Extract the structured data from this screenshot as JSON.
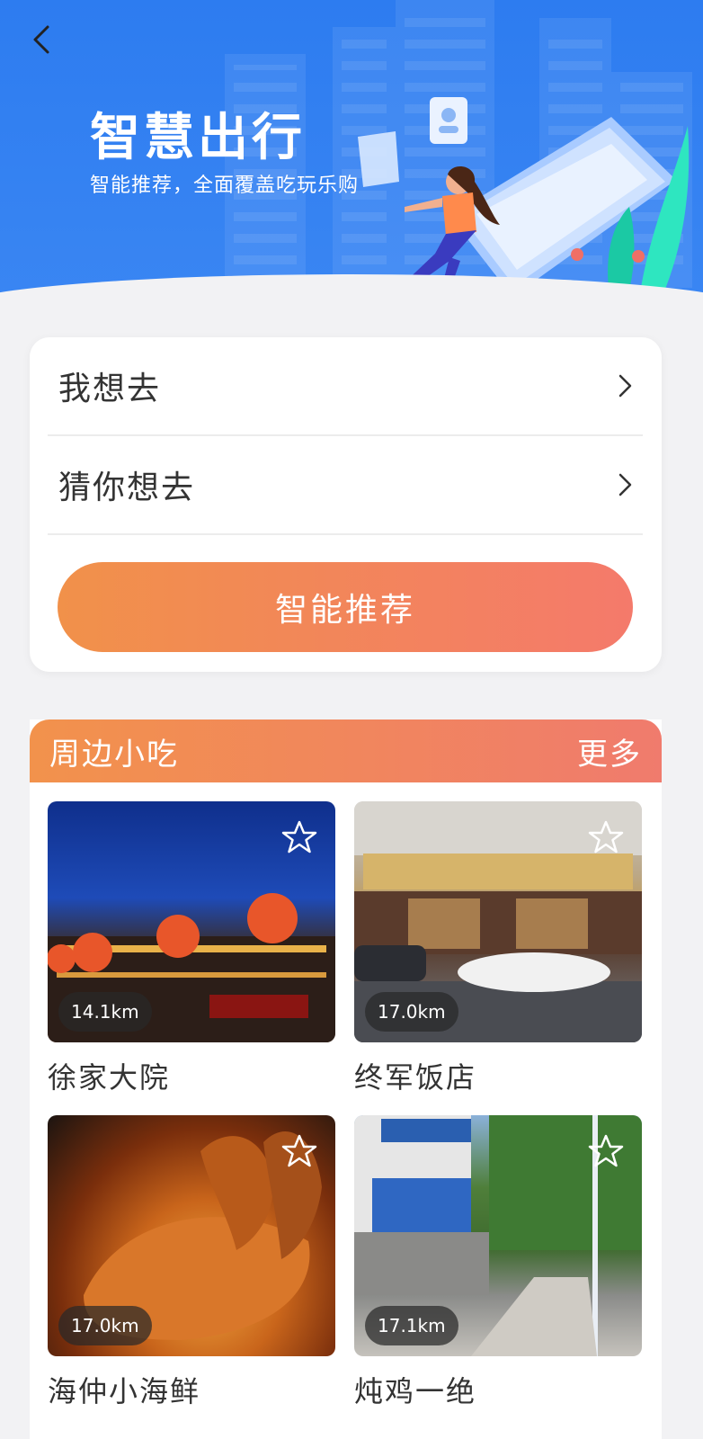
{
  "header": {
    "title": "智慧出行",
    "subtitle": "智能推荐，全面覆盖吃玩乐购"
  },
  "menu": {
    "rows": [
      {
        "label": "我想去"
      },
      {
        "label": "猜你想去"
      }
    ],
    "recommend_button": "智能推荐"
  },
  "snacks": {
    "title": "周边小吃",
    "more": "更多",
    "items": [
      {
        "name": "徐家大院",
        "distance": "14.1km",
        "favorited": false
      },
      {
        "name": "终军饭店",
        "distance": "17.0km",
        "favorited": false
      },
      {
        "name": "海仲小海鲜",
        "distance": "17.0km",
        "favorited": false
      },
      {
        "name": "炖鸡一绝",
        "distance": "17.1km",
        "favorited": false
      }
    ]
  },
  "colors": {
    "banner": "#2d7cf0",
    "accent_start": "#f1914a",
    "accent_end": "#f47a6b",
    "background": "#f2f2f4"
  },
  "icons": {
    "back": "back-arrow-icon",
    "chevron": "chevron-right-icon",
    "favorite": "star-outline-icon"
  }
}
